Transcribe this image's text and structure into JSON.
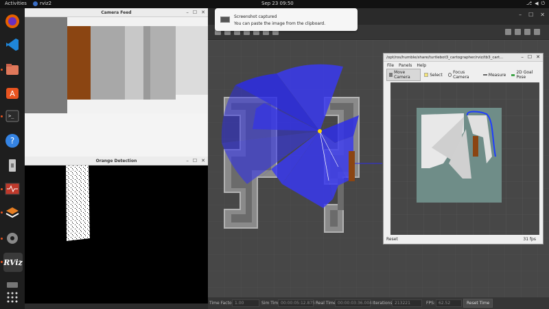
{
  "topbar": {
    "activities": "Activities",
    "app_name": "rviz2",
    "clock": "Sep 23  09:50",
    "tray_icons": [
      "network-icon",
      "volume-icon",
      "power-icon"
    ]
  },
  "dock": {
    "items": [
      {
        "name": "firefox-icon",
        "color": "#e66000"
      },
      {
        "name": "vscode-icon",
        "color": "#1f86d9"
      },
      {
        "name": "files-icon",
        "color": "#e0785a"
      },
      {
        "name": "app-store-icon",
        "color": "#e95420"
      },
      {
        "name": "terminal-icon",
        "color": "#2b2b2b"
      },
      {
        "name": "help-icon",
        "color": "#3584e4"
      },
      {
        "name": "text-editor-icon",
        "color": "#c8c8c8"
      },
      {
        "name": "system-monitor-icon",
        "color": "#c0392b"
      },
      {
        "name": "layers-icon",
        "color": "#e67e22"
      },
      {
        "name": "settings-icon",
        "color": "#888888"
      },
      {
        "name": "rviz-icon",
        "color": "#333333"
      },
      {
        "name": "drive-icon",
        "color": "#777777"
      },
      {
        "name": "app-grid-icon",
        "color": "#dddddd"
      }
    ],
    "rviz_label": "RViz"
  },
  "camera_window": {
    "title": "Camera Feed"
  },
  "orange_window": {
    "title": "Orange Detection"
  },
  "notification": {
    "title": "Screenshot captured",
    "body": "You can paste the image from the clipboard."
  },
  "rviz": {
    "status": {
      "time_factor_label": "Time Factor:",
      "time_factor": "1.00",
      "sim_time_label": "Sim Time:",
      "sim_time": "00:00:05:12.875",
      "real_time_label": "Real Time:",
      "real_time": "00:00:03:36.004",
      "iterations_label": "Iterations:",
      "iterations": "213221",
      "fps_label": "FPS:",
      "fps": "62.52",
      "reset_time": "Reset Time"
    }
  },
  "sub_rviz": {
    "title": "/opt/ros/humble/share/turtlebot3_cartographer/rviz/tb3_cart...",
    "menu": [
      "File",
      "Panels",
      "Help"
    ],
    "tools": [
      "Move Camera",
      "Select",
      "Focus Camera",
      "Measure",
      "2D Goal Pose"
    ],
    "reset": "Reset",
    "fps": "31 fps"
  },
  "colors": {
    "laser_blue": "#2d2de6",
    "orange_box": "#8b4512",
    "wall_gray": "#9a9a9a"
  }
}
